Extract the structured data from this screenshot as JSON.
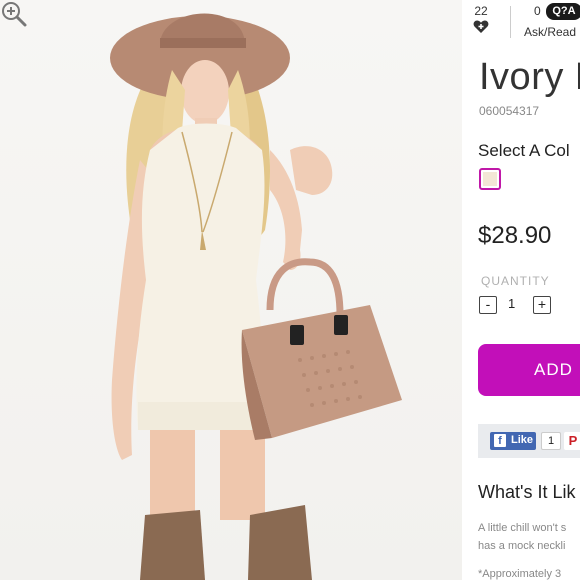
{
  "product": {
    "title": "Ivory D",
    "sku": "060054317",
    "color_label": "Select A Col",
    "swatch_color": "#f3e7d6",
    "price": "$28.90",
    "quantity_label": "QUANTITY",
    "quantity_value": "1",
    "minus_label": "-",
    "plus_label": "+",
    "add_button_label": "ADD"
  },
  "stats": {
    "likes_count": "22",
    "questions_count": "0",
    "qa_badge": "Q?A",
    "ask_label": "Ask/Read"
  },
  "social": {
    "like_label": "Like",
    "like_count": "1",
    "pin_label": "P"
  },
  "description": {
    "heading": "What's It Lik",
    "line1": "A little chill won't s",
    "line2": "has a mock neckli",
    "line3": "*Approximately 3"
  },
  "colors": {
    "accent": "#c20fb9",
    "facebook": "#4267b2"
  },
  "icons": {
    "heart": "heart-plus-icon",
    "zoom": "zoom-in-icon",
    "facebook": "facebook-icon",
    "pinterest": "pinterest-icon"
  }
}
